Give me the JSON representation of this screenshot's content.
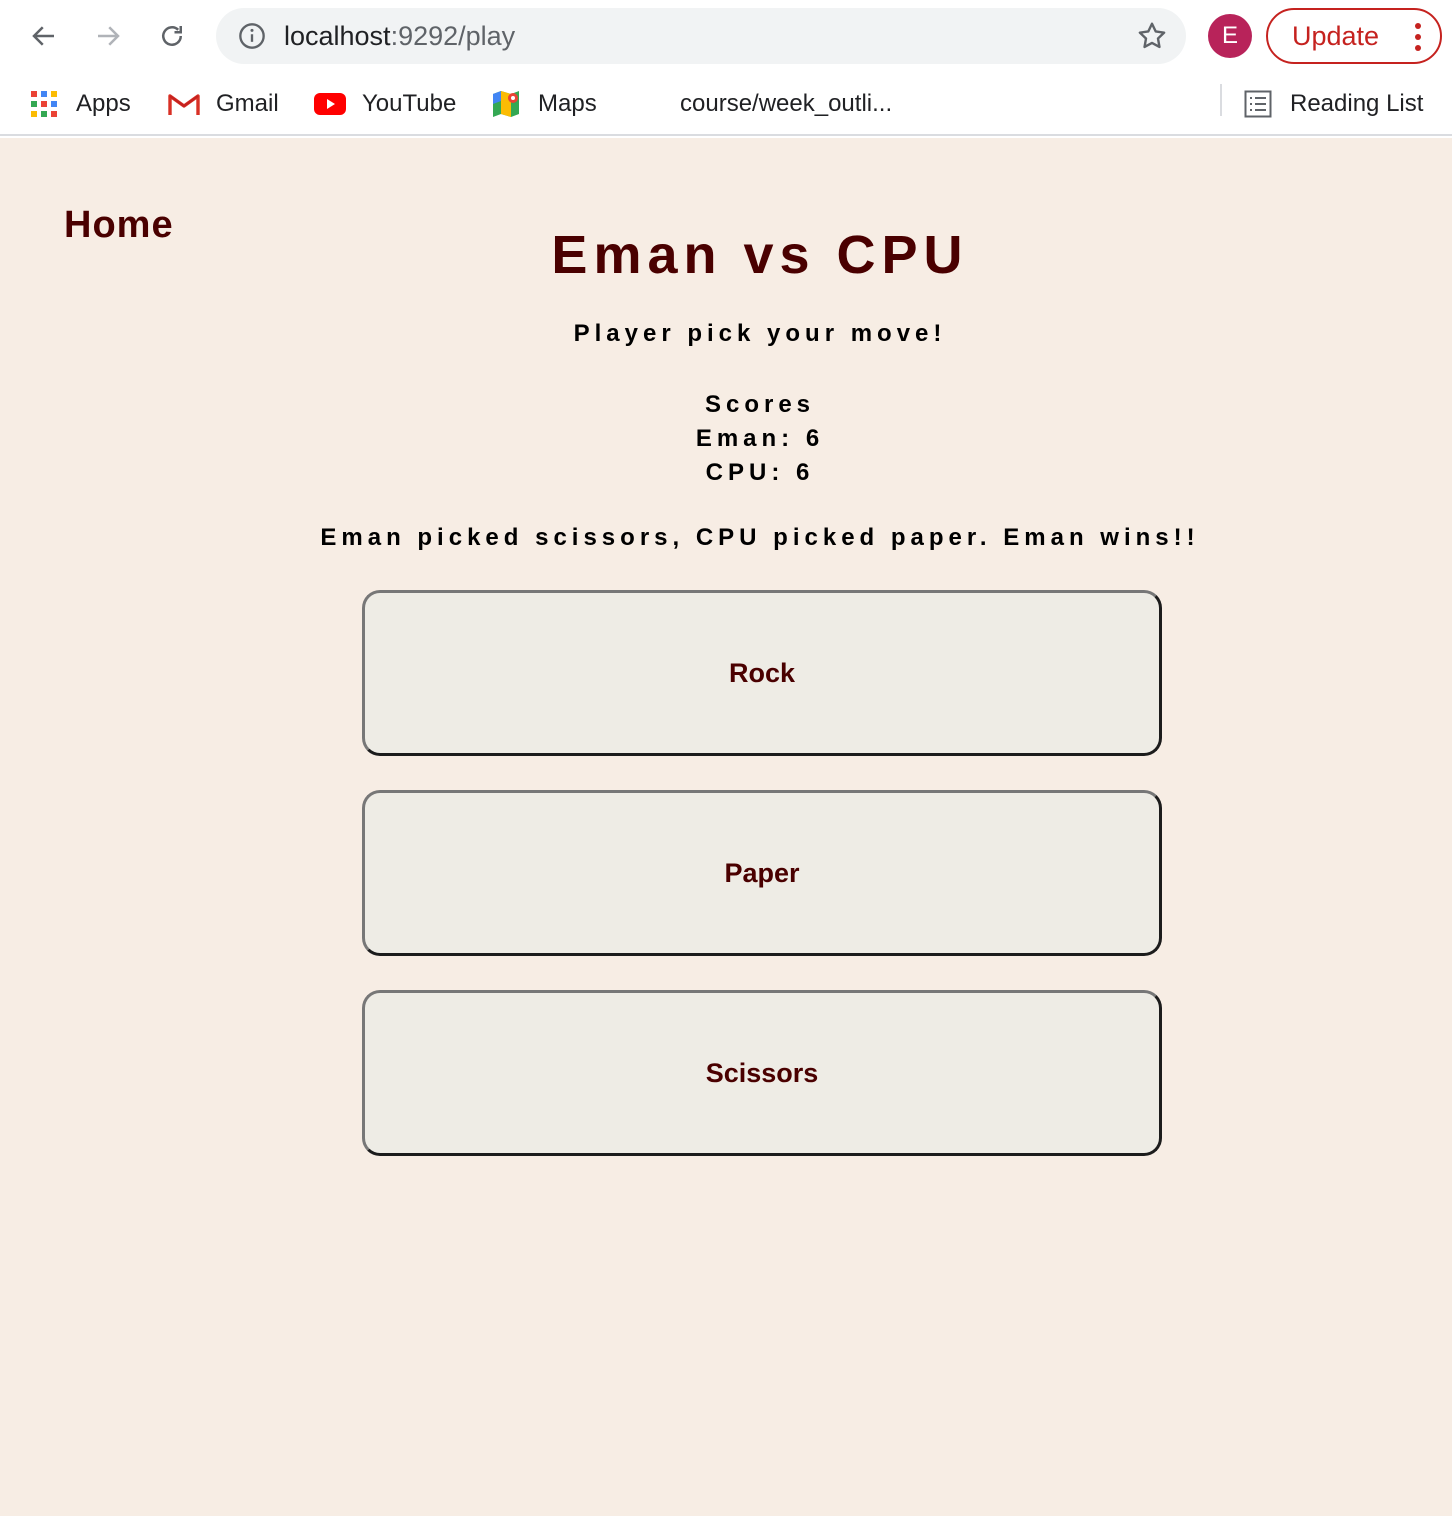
{
  "browser": {
    "url_host": "localhost",
    "url_rest": ":9292/play",
    "profile_initial": "E",
    "update_label": "Update",
    "bookmarks": [
      {
        "label": "Apps",
        "icon": "apps-grid-icon"
      },
      {
        "label": "Gmail",
        "icon": "gmail-icon"
      },
      {
        "label": "YouTube",
        "icon": "youtube-icon"
      },
      {
        "label": "Maps",
        "icon": "maps-icon"
      },
      {
        "label": "course/week_outli...",
        "icon": ""
      }
    ],
    "reading_list_label": "Reading List"
  },
  "page": {
    "home_link": "Home",
    "title": "Eman vs CPU",
    "prompt": "Player pick your move!",
    "scores": {
      "heading": "Scores",
      "player_line": "Eman: 6",
      "cpu_line": "CPU: 6"
    },
    "result": "Eman picked scissors, CPU picked paper. Eman wins!!",
    "moves": [
      "Rock",
      "Paper",
      "Scissors"
    ]
  },
  "colors": {
    "page_background": "#f7ede4",
    "accent_text": "#4a0000",
    "button_background": "#eeece5",
    "update_red": "#c5221f",
    "avatar": "#b8235a"
  }
}
